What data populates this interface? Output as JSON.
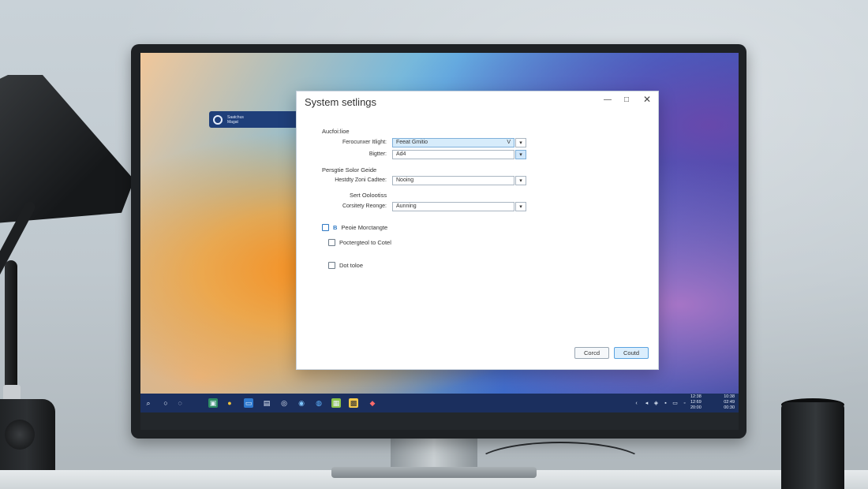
{
  "desktop_widget": {
    "line1": "Saatchus",
    "line2": "Magat"
  },
  "dialog": {
    "title": "System setlings",
    "window_controls": {
      "minimize": "—",
      "maximize": "□",
      "close": "✕"
    },
    "sections": {
      "s1": "Aucfoi:lioe",
      "s2": "Persgtie Solor Geide",
      "s3": "Sert Oolootiss"
    },
    "fields": {
      "f1": {
        "label": "Ferocunxer Itlight:",
        "value": "Feeat Gmitio",
        "inner_chevron": "V",
        "dropdown": "▾"
      },
      "f2": {
        "label": "Bigtter:",
        "value": "Ad4",
        "dropdown": "▾"
      },
      "f3": {
        "label": "Hestdty Zoni Cadtee:",
        "value": "Nooing",
        "dropdown": "▾"
      },
      "f4": {
        "label": "Corsitety Reonge:",
        "value": "Aunning",
        "dropdown": "▾"
      }
    },
    "checkboxes": {
      "c1": {
        "marker": "B",
        "label": "Peoie Morctangte"
      },
      "c2": {
        "label": "Poctergteol to Cotel"
      },
      "c3": {
        "label": "Dot toloe"
      }
    },
    "buttons": {
      "cancel": "Corcd",
      "ok": "Coutd"
    }
  },
  "taskbar": {
    "icons": {
      "search": "⌕",
      "ring1": "○",
      "ring2": "◌",
      "app1": "▣",
      "app2": "●",
      "app3": "▭",
      "app4": "▤",
      "app5": "◎",
      "app6": "◉",
      "app7": "◍",
      "app8": "▦",
      "app9": "▩",
      "app10": "◆"
    },
    "tray": [
      "‹",
      "◂",
      "◈",
      "▪",
      "▭",
      "◦"
    ],
    "clock": {
      "r1a": "12:38",
      "r1b": "10:38",
      "r2a": "12:69",
      "r2b": "02:49",
      "r3a": "20:00",
      "r3b": "00:30"
    }
  },
  "colors": {
    "accent": "#2f79c4",
    "taskbar": "#1b2f5e",
    "dialog_bg": "#ffffff"
  }
}
